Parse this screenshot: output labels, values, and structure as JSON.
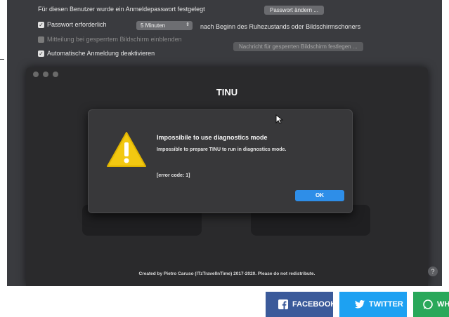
{
  "prefs": {
    "password_set_text": "Für diesen Benutzer wurde ein Anmeldepasswort festgelegt",
    "change_password_button": "Passwort ändern ...",
    "require_password_label": "Passwort erforderlich",
    "require_password_delay": "5 Minuten",
    "require_password_suffix": "nach Beginn des Ruhezustands oder Bildschirmschoners",
    "show_message_label": "Mitteilung bei gesperrtem Bildschirm einblenden",
    "set_message_button": "Nachricht für gesperrten Bildschirm festlegen ...",
    "disable_auto_login_label": "Automatische Anmeldung deaktivieren"
  },
  "tinu": {
    "title": "TINU",
    "footer": "Created by Pietro Caruso (ITzTravelInTime) 2017-2020. Please do not redistribute.",
    "help": "?"
  },
  "alert": {
    "title": "Impossibile to use diagnostics mode",
    "message": "Impossible to prepare TINU to run in diagnostics mode.",
    "code": "[error code: 1]",
    "ok_label": "OK"
  },
  "share": {
    "facebook": "FACEBOOK",
    "twitter": "TWITTER",
    "whatsapp": "WH"
  },
  "colors": {
    "ok_button": "#2e8ee8",
    "facebook": "#3b5a9a",
    "twitter": "#1da1f2",
    "whatsapp": "#29a85a",
    "warning": "#f2c811"
  }
}
